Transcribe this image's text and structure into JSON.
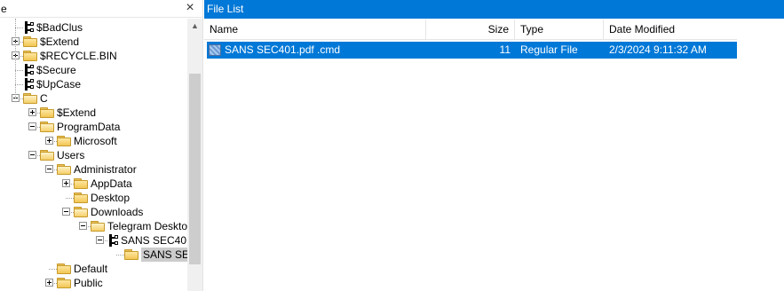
{
  "tree": {
    "header_title": "e",
    "close_glyph": "×",
    "nodes": [
      {
        "label": "$BadClus",
        "icon": "system-file-icon",
        "indent": 1,
        "expander": "none"
      },
      {
        "label": "$Extend",
        "icon": "folder-icon",
        "indent": 1,
        "expander": "plus"
      },
      {
        "label": "$RECYCLE.BIN",
        "icon": "folder-icon",
        "indent": 1,
        "expander": "plus"
      },
      {
        "label": "$Secure",
        "icon": "system-file-icon",
        "indent": 1,
        "expander": "none"
      },
      {
        "label": "$UpCase",
        "icon": "system-file-icon",
        "indent": 1,
        "expander": "none"
      },
      {
        "label": "C",
        "icon": "folder-icon",
        "indent": 1,
        "expander": "minus"
      },
      {
        "label": "$Extend",
        "icon": "folder-icon",
        "indent": 2,
        "expander": "plus"
      },
      {
        "label": "ProgramData",
        "icon": "folder-icon",
        "indent": 2,
        "expander": "minus"
      },
      {
        "label": "Microsoft",
        "icon": "folder-icon",
        "indent": 3,
        "expander": "plus"
      },
      {
        "label": "Users",
        "icon": "folder-icon",
        "indent": 2,
        "expander": "minus"
      },
      {
        "label": "Administrator",
        "icon": "folder-icon",
        "indent": 3,
        "expander": "minus"
      },
      {
        "label": "AppData",
        "icon": "folder-icon",
        "indent": 4,
        "expander": "plus"
      },
      {
        "label": "Desktop",
        "icon": "folder-icon",
        "indent": 4,
        "expander": "none"
      },
      {
        "label": "Downloads",
        "icon": "folder-icon",
        "indent": 4,
        "expander": "minus"
      },
      {
        "label": "Telegram Desktop",
        "icon": "folder-icon",
        "indent": 5,
        "expander": "minus"
      },
      {
        "label": "SANS SEC40",
        "icon": "system-file-icon",
        "indent": 6,
        "expander": "minus"
      },
      {
        "label": "SANS SE",
        "icon": "folder-icon",
        "indent": 7,
        "expander": "none",
        "selected": true
      },
      {
        "label": "Default",
        "icon": "folder-icon",
        "indent": 3,
        "expander": "none"
      },
      {
        "label": "Public",
        "icon": "folder-icon",
        "indent": 3,
        "expander": "plus"
      }
    ]
  },
  "file_list": {
    "title": "File List",
    "columns": {
      "name": "Name",
      "size": "Size",
      "type": "Type",
      "date": "Date Modified"
    },
    "rows": [
      {
        "name": "SANS SEC401.pdf .cmd",
        "size": "11",
        "type": "Regular File",
        "date": "2/3/2024 9:11:32 AM",
        "selected": true
      }
    ]
  },
  "colors": {
    "accent": "#0078d7",
    "selection_text": "#ffffff",
    "folder": "#f2c654"
  }
}
